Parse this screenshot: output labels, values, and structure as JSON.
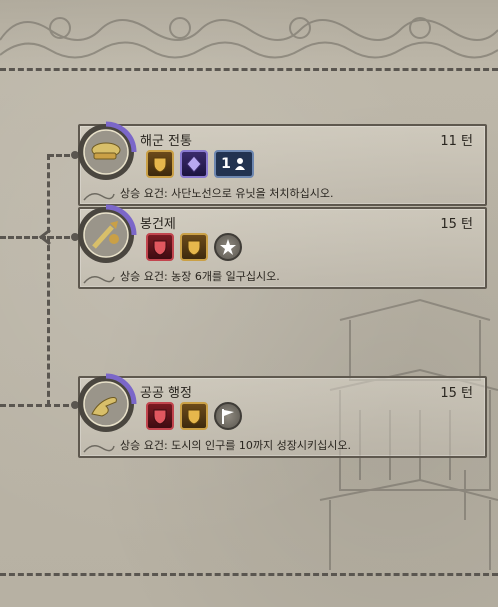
{
  "cards": [
    {
      "title": "해군 전통",
      "turns": "11 턴",
      "requirement": "상승 요건: 사단노선으로 유닛을 처치하십시오.",
      "medal_icon": "naval-cap-icon",
      "slot_icons": [
        "gold-shield-icon",
        "purple-gem-icon",
        "diplomatic-unit-icon"
      ],
      "diplomatic_count": "1"
    },
    {
      "title": "봉건제",
      "turns": "15 턴",
      "requirement": "상승 요건: 농장 6개를 일구십시오.",
      "medal_icon": "sword-icon",
      "slot_icons": [
        "red-shield-icon",
        "gold-shield-icon",
        "wildcard-star-icon"
      ]
    },
    {
      "title": "공공 행정",
      "turns": "15 턴",
      "requirement": "상승 요건: 도시의 인구를 10까지 성장시키십시오.",
      "medal_icon": "hand-icon",
      "slot_icons": [
        "red-shield-icon",
        "gold-shield-icon",
        "flag-icon"
      ]
    }
  ],
  "colors": {
    "accent_purple": "#7b67c9",
    "gold": "#caa046",
    "red": "#c2454e"
  }
}
